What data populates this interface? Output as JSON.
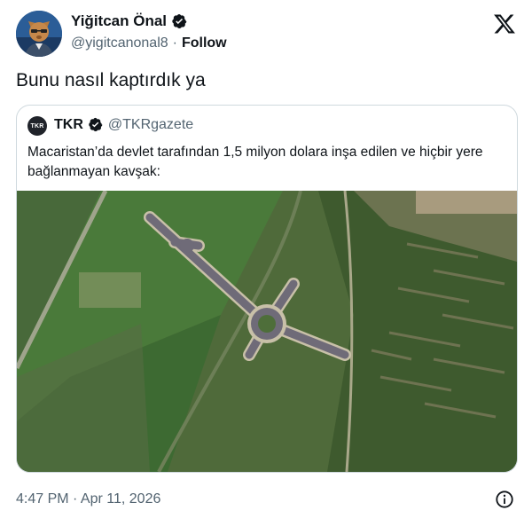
{
  "author": {
    "display_name": "Yiğitcan Önal",
    "handle": "@yigitcanonal8",
    "separator": "·",
    "follow_label": "Follow"
  },
  "tweet": {
    "text": "Bunu nasıl kaptırdık ya"
  },
  "quote": {
    "avatar_text": "TKR",
    "display_name": "TKR",
    "handle": "@TKRgazete",
    "text": "Macaristan’da devlet tarafından 1,5 milyon dolara inşa edilen ve hiçbir yere bağlanmayan kavşak:"
  },
  "footer": {
    "timestamp": "4:47 PM · Apr 11, 2026"
  },
  "icons": {
    "verified": "verified-badge-icon",
    "brand": "x-logo-icon",
    "info": "info-icon"
  },
  "colors": {
    "text_primary": "#0f1419",
    "text_secondary": "#536471",
    "border": "#cfd9de",
    "verified_badge": "#0f1419"
  }
}
